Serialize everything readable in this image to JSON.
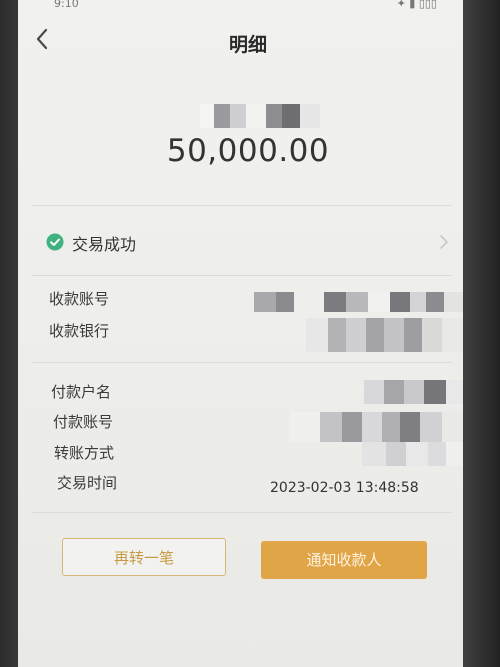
{
  "status_bar": {
    "time": "9:10",
    "icons": "✦ ▮ ▯▯▯"
  },
  "header": {
    "title": "明细"
  },
  "amount": "50,000.00",
  "transaction_status": {
    "label": "交易成功",
    "status_color": "#3fb27f"
  },
  "fields": {
    "payee_account": {
      "label": "收款账号"
    },
    "payee_bank": {
      "label": "收款银行"
    },
    "payer_name": {
      "label": "付款户名"
    },
    "payer_account": {
      "label": "付款账号"
    },
    "transfer_method": {
      "label": "转账方式"
    },
    "transaction_time": {
      "label": "交易时间",
      "value": "2023-02-03 13:48:58"
    }
  },
  "buttons": {
    "transfer_again": "再转一笔",
    "notify_payee": "通知收款人"
  },
  "colors": {
    "accent": "#e0a546",
    "outline": "#d7b775"
  }
}
